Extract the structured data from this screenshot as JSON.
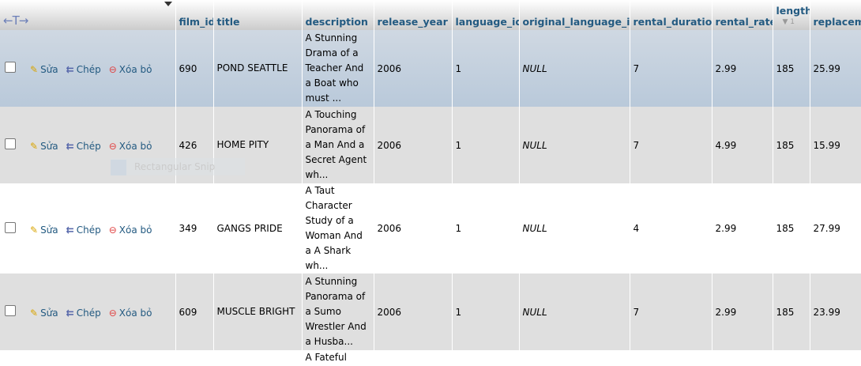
{
  "header": {
    "arrows": "←T→",
    "columns": [
      "film_id",
      "title",
      "description",
      "release_year",
      "language_id",
      "original_language_id",
      "rental_duration",
      "rental_rate",
      "length",
      "replaceme"
    ],
    "length_sort_index": "1"
  },
  "actions": {
    "edit": "Sửa",
    "copy": "Chép",
    "delete": "Xóa bỏ"
  },
  "rows": [
    {
      "film_id": "690",
      "title": "POND SEATTLE",
      "description": "A Stunning Drama of a Teacher And a Boat who must ...",
      "release_year": "2006",
      "language_id": "1",
      "original_language_id": "NULL",
      "rental_duration": "7",
      "rental_rate": "2.99",
      "length": "185",
      "replacement": "25.99"
    },
    {
      "film_id": "426",
      "title": "HOME PITY",
      "description": "A Touching Panorama of a Man And a Secret Agent wh...",
      "release_year": "2006",
      "language_id": "1",
      "original_language_id": "NULL",
      "rental_duration": "7",
      "rental_rate": "4.99",
      "length": "185",
      "replacement": "15.99"
    },
    {
      "film_id": "349",
      "title": "GANGS PRIDE",
      "description": "A Taut Character Study of a Woman And a A Shark wh...",
      "release_year": "2006",
      "language_id": "1",
      "original_language_id": "NULL",
      "rental_duration": "4",
      "rental_rate": "2.99",
      "length": "185",
      "replacement": "27.99"
    },
    {
      "film_id": "609",
      "title": "MUSCLE BRIGHT",
      "description": "A Stunning Panorama of a Sumo Wrestler And a Husba...",
      "release_year": "2006",
      "language_id": "1",
      "original_language_id": "NULL",
      "rental_duration": "7",
      "rental_rate": "2.99",
      "length": "185",
      "replacement": "23.99"
    }
  ],
  "partial_row": {
    "description": "A Fateful"
  },
  "overlay": {
    "label": "Rectangular Snip"
  }
}
